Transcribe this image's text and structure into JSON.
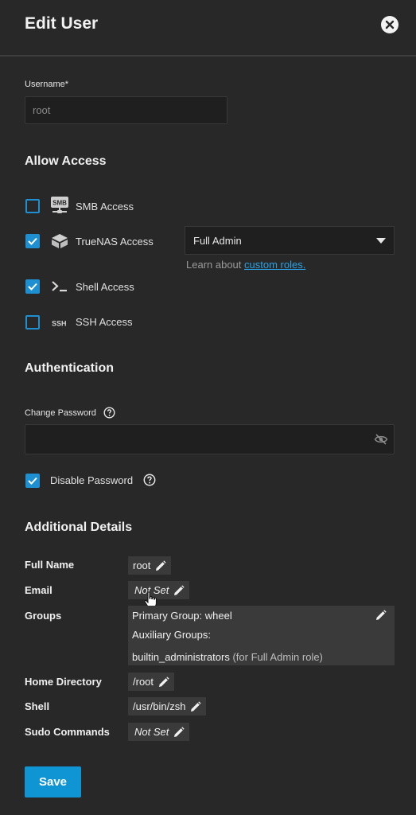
{
  "header": {
    "title": "Edit User",
    "close_icon": "close-icon"
  },
  "username": {
    "label": "Username",
    "required_marker": "*",
    "value": "root"
  },
  "allow_access": {
    "title": "Allow Access",
    "items": [
      {
        "label": "SMB Access",
        "checked": false,
        "icon": "smb-icon"
      },
      {
        "label": "TrueNAS Access",
        "checked": true,
        "icon": "truenas-icon"
      },
      {
        "label": "Shell Access",
        "checked": true,
        "icon": "terminal-icon"
      },
      {
        "label": "SSH Access",
        "checked": false,
        "icon": "ssh-icon"
      }
    ],
    "role_select": {
      "value": "Full Admin"
    },
    "roles_hint": {
      "prefix": "Learn about ",
      "link": "custom roles."
    }
  },
  "authentication": {
    "title": "Authentication",
    "change_password_label": "Change Password",
    "password_value": "",
    "disable_password": {
      "label": "Disable Password",
      "checked": true
    }
  },
  "details": {
    "title": "Additional Details",
    "full_name": {
      "label": "Full Name",
      "value": "root"
    },
    "email": {
      "label": "Email",
      "value": "Not Set"
    },
    "groups": {
      "label": "Groups",
      "primary": "Primary Group: wheel",
      "auxiliary_label": "Auxiliary Groups:",
      "auxiliary_value": "builtin_administrators",
      "auxiliary_note": "(for Full Admin role)"
    },
    "home_directory": {
      "label": "Home Directory",
      "value": "/root"
    },
    "shell": {
      "label": "Shell",
      "value": "/usr/bin/zsh"
    },
    "sudo_commands": {
      "label": "Sudo Commands",
      "value": "Not Set"
    }
  },
  "actions": {
    "save_label": "Save"
  },
  "colors": {
    "background": "#282828",
    "accent": "#0f95d4",
    "chip": "#3a3a3a",
    "link": "#2aa3e6"
  }
}
